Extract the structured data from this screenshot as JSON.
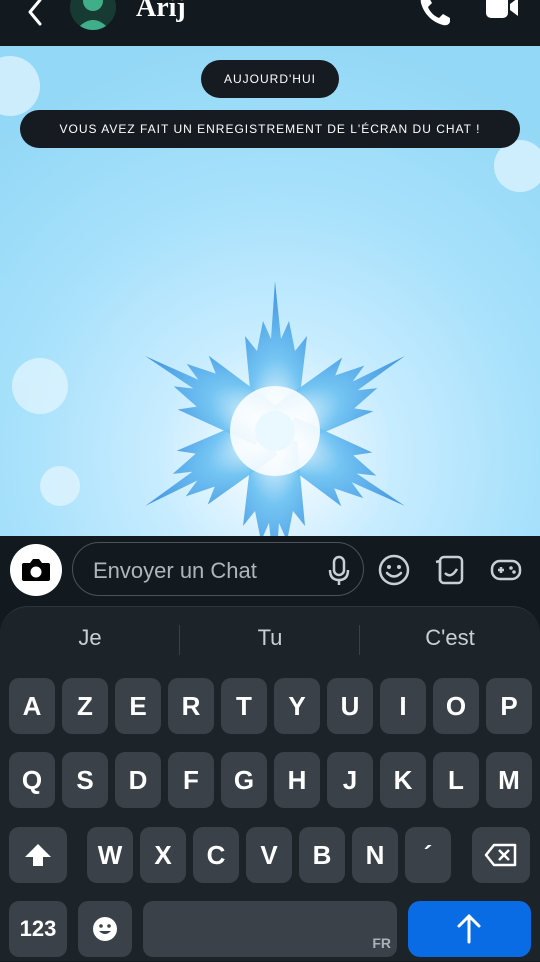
{
  "header": {
    "title": "Arij",
    "back_icon": "chevron-left-icon",
    "call_icon": "phone-icon",
    "video_icon": "video-camera-icon"
  },
  "chat": {
    "date_label": "AUJOURD'HUI",
    "notice": "VOUS AVEZ FAIT UN ENREGISTREMENT DE L'ÉCRAN DU CHAT !"
  },
  "composer": {
    "placeholder": "Envoyer un Chat",
    "tools": [
      "camera-icon",
      "microphone-icon",
      "emoji-icon",
      "sticker-icon",
      "gamepad-icon"
    ]
  },
  "keyboard": {
    "suggestions": [
      "Je",
      "Tu",
      "C'est"
    ],
    "row1": [
      "A",
      "Z",
      "E",
      "R",
      "T",
      "Y",
      "U",
      "I",
      "O",
      "P"
    ],
    "row2": [
      "Q",
      "S",
      "D",
      "F",
      "G",
      "H",
      "J",
      "K",
      "L",
      "M"
    ],
    "row3": [
      "W",
      "X",
      "C",
      "V",
      "B",
      "N",
      "´"
    ],
    "numbers_key": "123",
    "space_language": "FR",
    "accent_color": "#0a6ce5"
  }
}
